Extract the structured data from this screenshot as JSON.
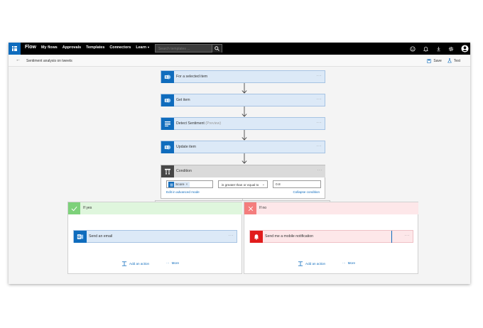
{
  "topbar": {
    "brand": "Flow",
    "nav": [
      "My flows",
      "Approvals",
      "Templates",
      "Connectors",
      "Learn"
    ],
    "search_placeholder": "Search templates ...",
    "icons": [
      "waffle-icon",
      "search-icon",
      "smiley-icon",
      "bell-icon",
      "download-icon",
      "gear-icon",
      "user-icon"
    ]
  },
  "subbar": {
    "flow_name": "Sentiment analysis on tweets",
    "save_label": "Save",
    "test_label": "Test"
  },
  "steps": [
    {
      "label": "For a selected item",
      "icon": "sharepoint-icon"
    },
    {
      "label": "Get item",
      "icon": "sharepoint-icon"
    },
    {
      "label": "Detect Sentiment",
      "preview": "(Preview)",
      "icon": "text-analytics-icon"
    },
    {
      "label": "Update item",
      "icon": "sharepoint-icon"
    }
  ],
  "condition": {
    "title": "Condition",
    "token": "Score",
    "operator": "is greater than or equal to",
    "value": "0.8",
    "edit_link": "Edit in advanced mode",
    "collapse_link": "Collapse condition"
  },
  "branches": {
    "yes": {
      "label": "If yes",
      "action": "Send an email",
      "add_action": "Add an action",
      "more": "More",
      "color": "#dff6dd"
    },
    "no": {
      "label": "If no",
      "action": "Send me a mobile notification",
      "add_action": "Add an action",
      "more": "More",
      "color": "#fde7e9"
    }
  },
  "colors": {
    "accent": "#0f6cbd",
    "step_bg": "#dce9f7",
    "yes_icon": "#7dd17a",
    "no_icon": "#f47d7d",
    "notify_icon": "#e11c1c",
    "outlook_icon": "#0f6cbd"
  }
}
